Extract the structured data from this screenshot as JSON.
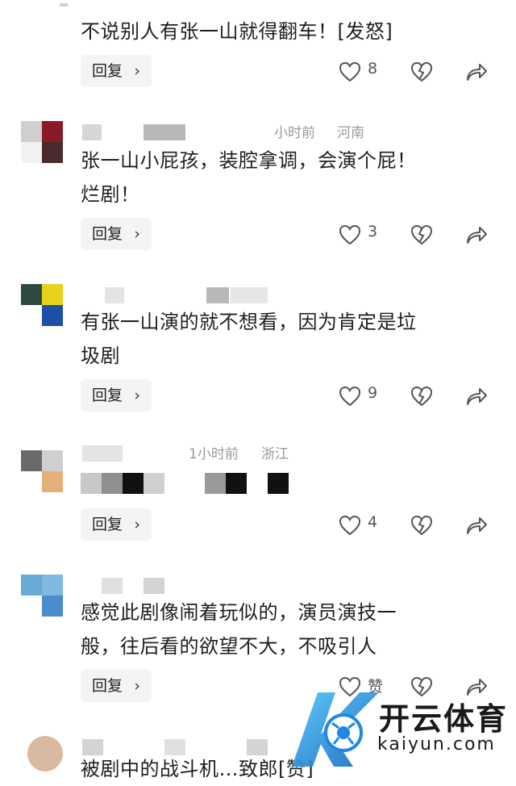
{
  "comments": [
    {
      "text": "不说别人有张一山就得翻车！[发怒]",
      "reply_label": "回复",
      "likes": "8"
    },
    {
      "time": "小时前",
      "location": "河南",
      "text_line1": "张一山小屁孩，装腔拿调，会演个屁！",
      "text_line2": "烂剧！",
      "reply_label": "回复",
      "likes": "3"
    },
    {
      "time": "",
      "location": "",
      "text_line1": "有张一山演的就不想看，因为肯定是垃",
      "text_line2": "圾剧",
      "reply_label": "回复",
      "likes": "9"
    },
    {
      "time": "1小时前",
      "location": "浙江",
      "reply_label": "回复",
      "likes": "4"
    },
    {
      "text_line1": "感觉此剧像闹着玩似的，演员演技一",
      "text_line2": "般，往后看的欲望不大，不吸引人",
      "reply_label": "回复",
      "likes": "赞"
    },
    {
      "text_line1": "被剧中的战斗机…致郎[赞]"
    }
  ],
  "watermark": {
    "name": "开云体育",
    "url": "kaiyun.com"
  },
  "colors": {
    "text": "#1f1f1f",
    "meta": "#9a9a9a",
    "reply_bg": "#f4f4f4",
    "icon": "#555555",
    "brand_blue": "#1e88e5"
  }
}
